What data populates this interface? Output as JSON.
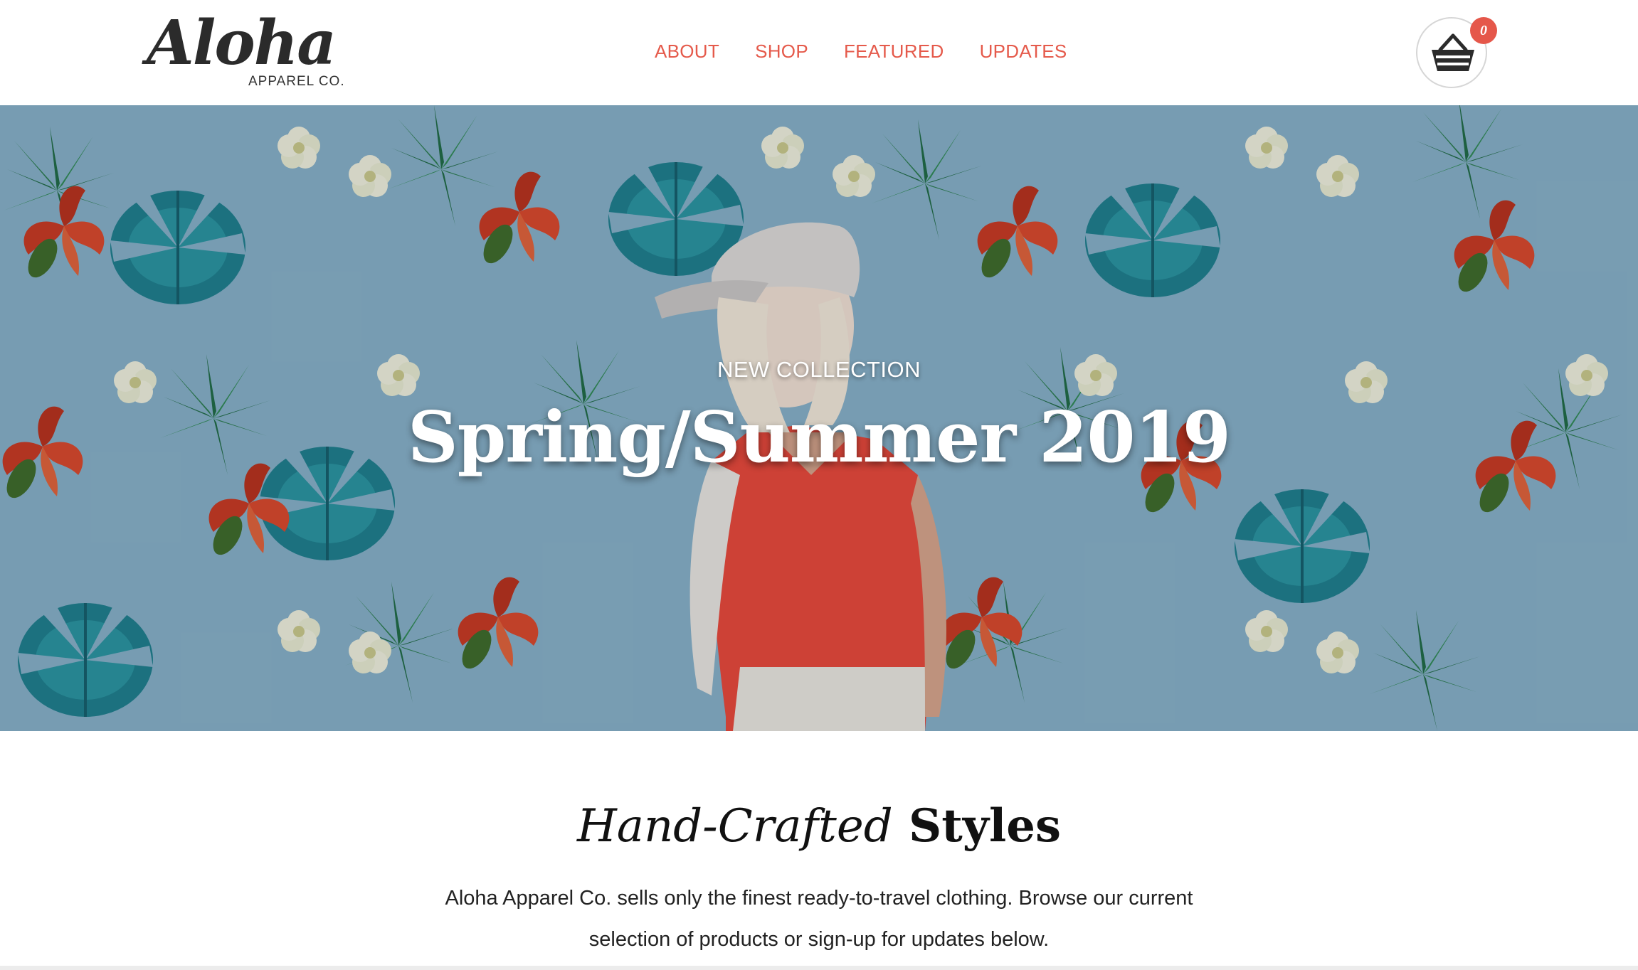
{
  "header": {
    "logo": {
      "script": "Aloha",
      "sub": "APPAREL CO."
    },
    "nav": [
      {
        "label": "ABOUT"
      },
      {
        "label": "SHOP"
      },
      {
        "label": "FEATURED"
      },
      {
        "label": "UPDATES"
      }
    ],
    "cart": {
      "icon": "basket-icon",
      "count": "0"
    }
  },
  "hero": {
    "eyebrow": "NEW COLLECTION",
    "title": "Spring/Summer 2019"
  },
  "intro": {
    "heading_italic": "Hand-Crafted",
    "heading_bold": "Styles",
    "text": "Aloha Apparel Co. sells only the finest ready-to-travel clothing. Browse our current selection of products or sign-up for updates below."
  },
  "colors": {
    "accent": "#e55a4b",
    "badge": "#e5574a",
    "hero_bg": "#86b0c6"
  }
}
